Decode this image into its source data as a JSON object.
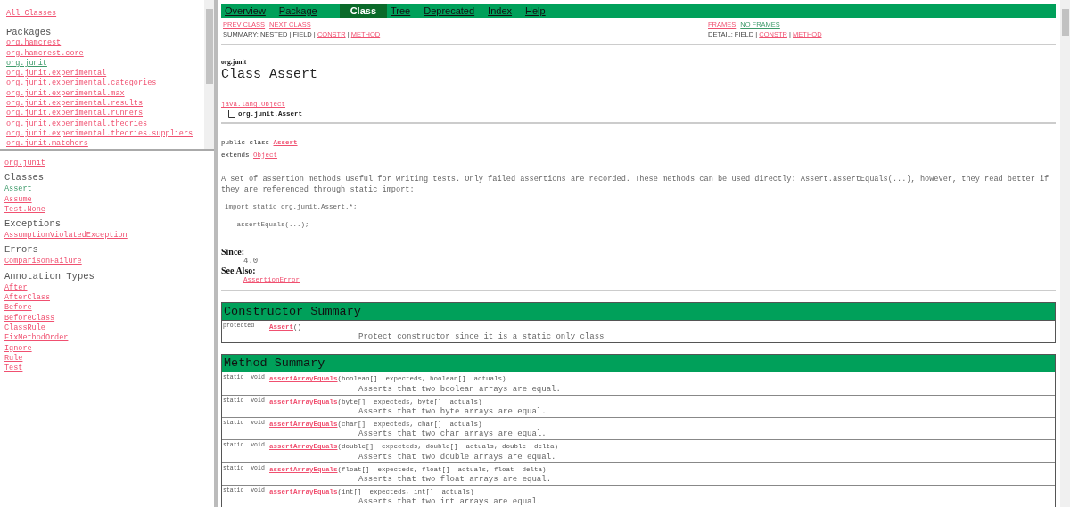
{
  "packages_frame": {
    "all_classes": {
      "label": "All Classes",
      "visited": false
    },
    "heading": "Packages",
    "items": [
      {
        "label": "org.hamcrest",
        "visited": false
      },
      {
        "label": "org.hamcrest.core",
        "visited": false
      },
      {
        "label": "org.junit",
        "visited": true
      },
      {
        "label": "org.junit.experimental",
        "visited": false
      },
      {
        "label": "org.junit.experimental.categories",
        "visited": false
      },
      {
        "label": "org.junit.experimental.max",
        "visited": false
      },
      {
        "label": "org.junit.experimental.results",
        "visited": false
      },
      {
        "label": "org.junit.experimental.runners",
        "visited": false
      },
      {
        "label": "org.junit.experimental.theories",
        "visited": false
      },
      {
        "label": "org.junit.experimental.theories.suppliers",
        "visited": false
      },
      {
        "label": "org.junit.matchers",
        "visited": false
      }
    ]
  },
  "classes_frame": {
    "package": {
      "label": "org.junit",
      "visited": false
    },
    "groups": [
      {
        "heading": "Classes",
        "items": [
          {
            "label": "Assert",
            "visited": true
          },
          {
            "label": "Assume",
            "visited": false
          },
          {
            "label": "Test.None",
            "visited": false
          }
        ]
      },
      {
        "heading": "Exceptions",
        "items": [
          {
            "label": "AssumptionViolatedException",
            "visited": false
          }
        ]
      },
      {
        "heading": "Errors",
        "items": [
          {
            "label": "ComparisonFailure",
            "visited": false
          }
        ]
      },
      {
        "heading": "Annotation Types",
        "items": [
          {
            "label": "After",
            "visited": false
          },
          {
            "label": "AfterClass",
            "visited": false
          },
          {
            "label": "Before",
            "visited": false
          },
          {
            "label": "BeforeClass",
            "visited": false
          },
          {
            "label": "ClassRule",
            "visited": false
          },
          {
            "label": "FixMethodOrder",
            "visited": false
          },
          {
            "label": "Ignore",
            "visited": false
          },
          {
            "label": "Rule",
            "visited": false
          },
          {
            "label": "Test",
            "visited": false
          }
        ]
      }
    ]
  },
  "navbar": [
    {
      "label": "Overview",
      "selected": false
    },
    {
      "label": "Package",
      "selected": false
    },
    {
      "label": "Class",
      "selected": true
    },
    {
      "label": "Tree",
      "selected": false
    },
    {
      "label": "Deprecated",
      "selected": false
    },
    {
      "label": "Index",
      "selected": false
    },
    {
      "label": "Help",
      "selected": false
    }
  ],
  "subnav": {
    "class_links": [
      {
        "label": "PREV CLASS",
        "visited": false
      },
      {
        "label": "NEXT CLASS",
        "visited": false
      }
    ],
    "frame_links": [
      {
        "label": "FRAMES",
        "visited": false
      },
      {
        "label": "NO FRAMES",
        "visited": true
      }
    ],
    "summary": [
      {
        "text": "SUMMARY: NESTED | FIELD | ",
        "link": false
      },
      {
        "text": "CONSTR",
        "link": true
      },
      {
        "text": " | ",
        "link": false
      },
      {
        "text": "METHOD",
        "link": true
      }
    ],
    "detail": [
      {
        "text": "DETAIL: FIELD | ",
        "link": false
      },
      {
        "text": "CONSTR",
        "link": true
      },
      {
        "text": " | ",
        "link": false
      },
      {
        "text": "METHOD",
        "link": true
      }
    ]
  },
  "class_header": {
    "package": "org.junit",
    "title": "Class Assert",
    "superclass": "java.lang.Object",
    "class_name": "org.junit.Assert"
  },
  "declaration": {
    "prefix": "public class ",
    "name": "Assert",
    "extends": "extends ",
    "superclass": "Object"
  },
  "description": "A set of assertion methods useful for writing tests. Only failed assertions are recorded. These methods can be used directly: Assert.assertEquals(...), however, they read better if they are referenced through static import:",
  "code_lines": [
    "import static org.junit.Assert.*;",
    "   ...",
    "   assertEquals(...);"
  ],
  "since": {
    "label": "Since:",
    "value": "4.0"
  },
  "see_also": {
    "label": "See Also:",
    "link": "AssertionError"
  },
  "constructor_summary": {
    "title": "Constructor Summary",
    "rows": [
      {
        "modifier": "protected",
        "name": "Assert",
        "signature": "()",
        "description": "Protect constructor since it is a static only class"
      }
    ]
  },
  "method_summary": {
    "title": "Method Summary",
    "rows": [
      {
        "modifier": "static  void",
        "name": "assertArrayEquals",
        "signature": "(boolean[]  expecteds, boolean[]  actuals)",
        "description": "Asserts that two boolean arrays are equal."
      },
      {
        "modifier": "static  void",
        "name": "assertArrayEquals",
        "signature": "(byte[]  expecteds, byte[]  actuals)",
        "description": "Asserts that two byte arrays are equal."
      },
      {
        "modifier": "static  void",
        "name": "assertArrayEquals",
        "signature": "(char[]  expecteds, char[]  actuals)",
        "description": "Asserts that two char arrays are equal."
      },
      {
        "modifier": "static  void",
        "name": "assertArrayEquals",
        "signature": "(double[]  expecteds, double[]  actuals, double  delta)",
        "description": "Asserts that two double arrays are equal."
      },
      {
        "modifier": "static  void",
        "name": "assertArrayEquals",
        "signature": "(float[]  expecteds, float[]  actuals, float  delta)",
        "description": "Asserts that two float arrays are equal."
      },
      {
        "modifier": "static  void",
        "name": "assertArrayEquals",
        "signature": "(int[]  expecteds, int[]  actuals)",
        "description": "Asserts that two int arrays are equal."
      }
    ]
  }
}
